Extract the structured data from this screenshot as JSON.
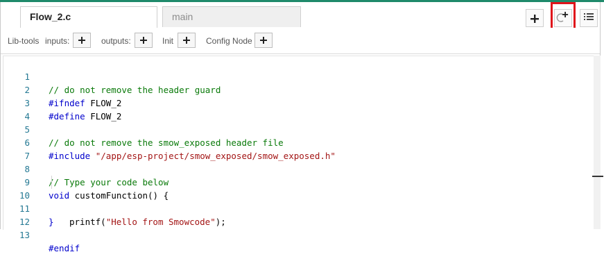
{
  "tabs": [
    {
      "label": "Flow_2.c",
      "active": true
    },
    {
      "label": "main",
      "active": false
    }
  ],
  "header_icons": [
    "plus-icon",
    "refresh-plus-icon",
    "list-icon"
  ],
  "toolbar": {
    "lib_tools": "Lib-tools",
    "inputs": "inputs:",
    "outputs": "outputs:",
    "init": "Init",
    "config_node": "Config Node"
  },
  "colors": {
    "accent_line": "#1f8a6b",
    "highlight_box": "#e0141b",
    "comment": "#0a7a0a",
    "keyword": "#0000cc",
    "string": "#a31515",
    "line_number": "#237893"
  },
  "code": {
    "line_numbers": [
      "1",
      "2",
      "3",
      "4",
      "5",
      "6",
      "7",
      "8",
      "9",
      "10",
      "11",
      "12",
      "13"
    ],
    "l1": "// do not remove the header guard",
    "l2_kw": "#ifndef",
    "l2_rest": " FLOW_2",
    "l3_kw": "#define",
    "l3_rest": " FLOW_2",
    "l5": "// do not remove the smow_exposed header file",
    "l6_kw": "#include",
    "l6_str": " \"/app/esp-project/smow_exposed/smow_exposed.h\"",
    "l8": "// Type your code below",
    "l9_kw": "void",
    "l9_rest": " customFunction() {",
    "l10_fn": "printf(",
    "l10_str": "\"Hello from Smowcode\"",
    "l10_end": ");",
    "l11": "}",
    "l13": "#endif"
  }
}
